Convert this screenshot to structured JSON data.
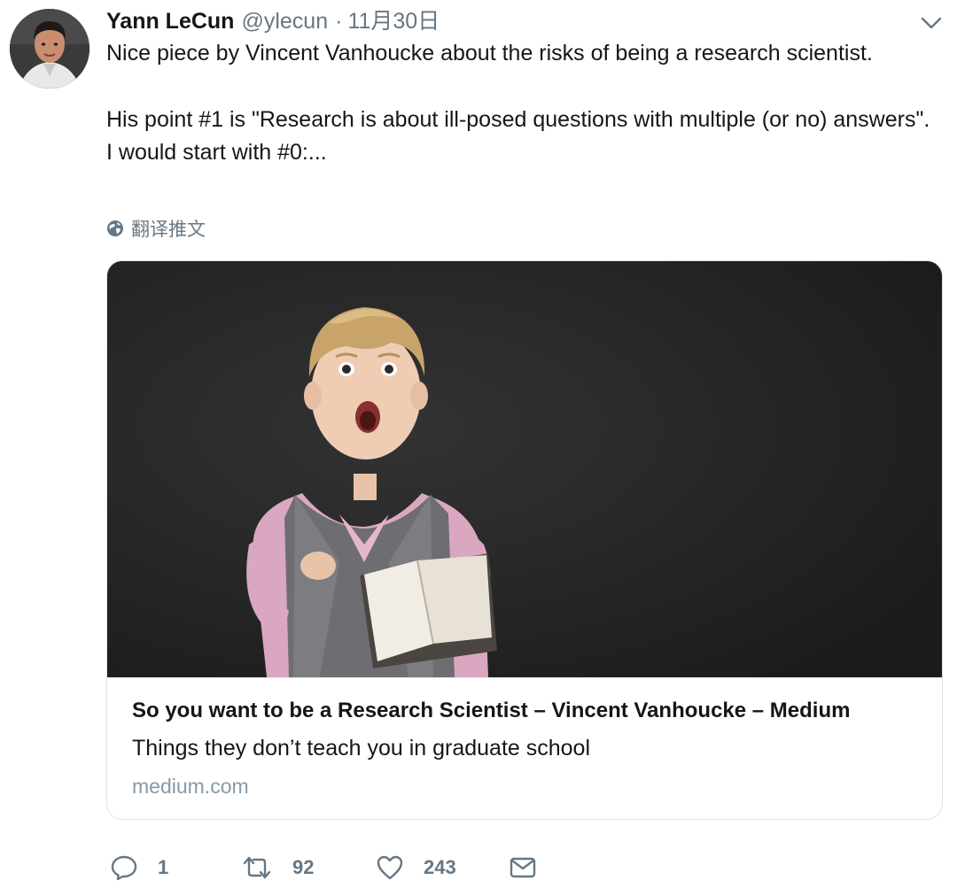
{
  "tweet": {
    "display_name": "Yann LeCun",
    "handle": "@ylecun",
    "separator": "·",
    "timestamp": "11月30日",
    "lines": [
      "Nice piece by Vincent Vanhoucke about the risks of being a research scientist.",
      "His point #1 is \"Research is about ill-posed questions with multiple (or no) answers\".",
      "I would start with #0:..."
    ],
    "translate_label": "翻译推文"
  },
  "card": {
    "title": "So you want to be a Research Scientist – Vincent Vanhoucke – Medium",
    "description": "Things they don’t teach you in graduate school",
    "domain": "medium.com",
    "image_icon": "photo-child-with-book"
  },
  "actions": {
    "reply_count": "1",
    "retweet_count": "92",
    "like_count": "243"
  },
  "icons": {
    "caret": "chevron-down-icon",
    "globe": "globe-icon",
    "reply": "reply-icon",
    "retweet": "retweet-icon",
    "like": "heart-icon",
    "message": "envelope-icon"
  },
  "colors": {
    "text": "#14171a",
    "secondary": "#657786",
    "domain": "#8899a6",
    "card_border": "#dfe3e8",
    "image_background": "#262626"
  }
}
